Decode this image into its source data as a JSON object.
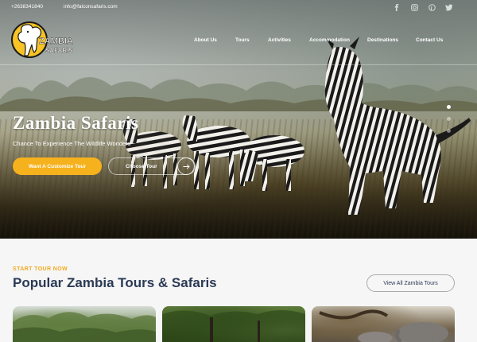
{
  "topbar": {
    "phone": "+2638341840",
    "email": "info@falconsafaris.com",
    "socials": [
      "facebook-icon",
      "instagram-icon",
      "pinterest-icon",
      "twitter-icon"
    ]
  },
  "logo": {
    "line1": "ZAMBIA",
    "line2": "SAFARIS"
  },
  "nav": {
    "items": [
      "About Us",
      "Tours",
      "Activities",
      "Accommodation",
      "Destinations",
      "Contact Us"
    ]
  },
  "hero": {
    "title": "Zambia Safaris",
    "subtitle": "Chance To Experience The Wildlife Wonders",
    "primary_button": "Want A Customize Tour",
    "secondary_button": "Choose Tour",
    "slide_count": 3,
    "active_slide": 1
  },
  "section": {
    "eyebrow": "START TOUR NOW",
    "title": "Popular Zambia Tours & Safaris",
    "view_all": "View All Zambia Tours"
  },
  "colors": {
    "accent": "#f6b21d",
    "heading": "#2b3a55",
    "eyebrow": "#f2a91e"
  }
}
